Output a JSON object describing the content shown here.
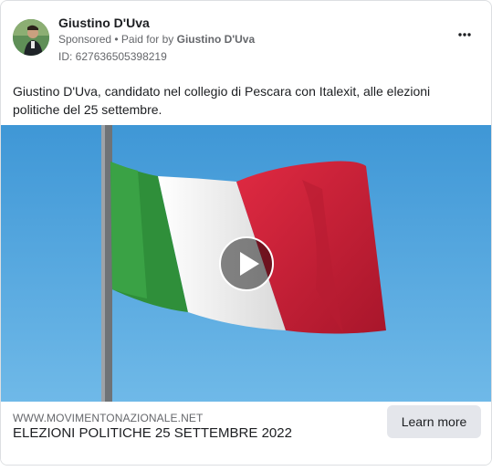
{
  "ad": {
    "advertiser_name": "Giustino D'Uva",
    "sponsored_label": "Sponsored",
    "separator": " • ",
    "paid_for_prefix": "Paid for by ",
    "paid_for_name": "Giustino D'Uva",
    "ad_id": "ID: 627636505398219",
    "more_icon": "more-horizontal-icon",
    "body_text": "Giustino D'Uva, candidato nel collegio di Pescara con Italexit, alle elezioni politiche del 25 settembre.",
    "media": {
      "type": "video",
      "play_icon": "play-icon"
    },
    "link": {
      "domain": "WWW.MOVIMENTONAZIONALE.NET",
      "title": "ELEZIONI POLITICHE 25 SETTEMBRE 2022",
      "cta_label": "Learn more"
    }
  },
  "colors": {
    "text_primary": "#1c1e21",
    "text_secondary": "#65676b",
    "button_bg": "#e4e6eb",
    "sky": "#4da3dc",
    "flag_green": "#2f8f3a",
    "flag_white": "#f2f2f2",
    "flag_red": "#d6233b"
  }
}
